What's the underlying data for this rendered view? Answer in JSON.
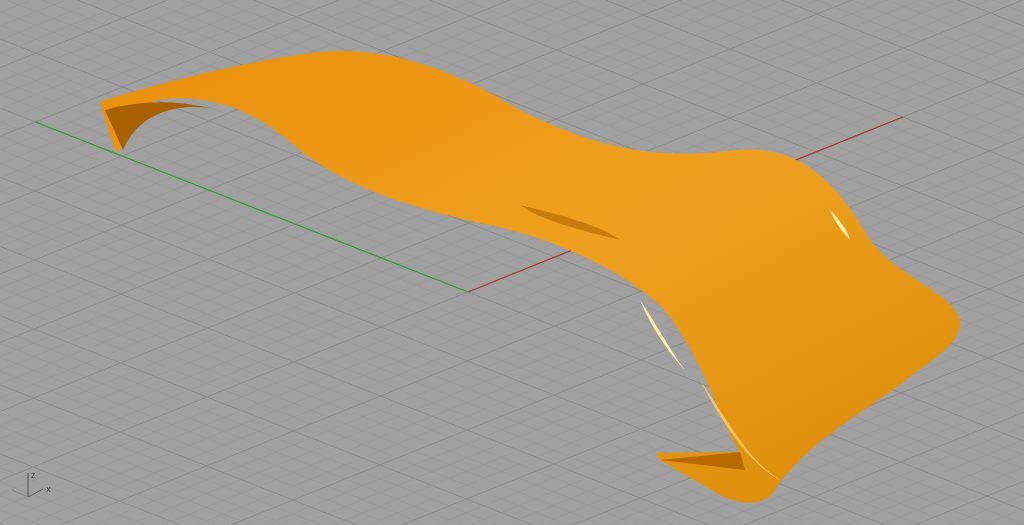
{
  "viewport": {
    "axis_gizmo": {
      "z_label": "z",
      "x_label": "x"
    }
  }
}
